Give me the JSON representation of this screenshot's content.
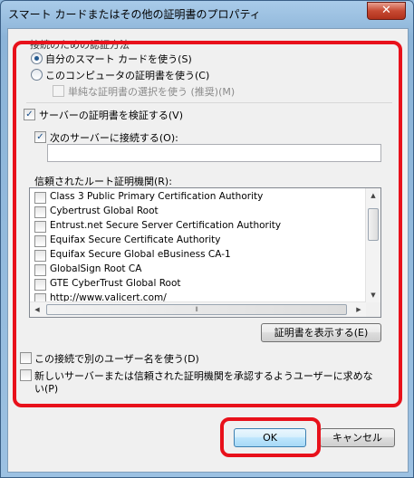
{
  "window": {
    "title": "スマート カードまたはその他の証明書のプロパティ",
    "close_symbol": "✕"
  },
  "connect_group": {
    "label": "接続のための認証方法",
    "options": [
      {
        "label": "自分のスマート カードを使う(S)",
        "selected": true
      },
      {
        "label": "このコンピュータの証明書を使う(C)",
        "selected": false
      }
    ],
    "simple_select": {
      "label": "単純な証明書の選択を使う (推奨)(M)",
      "checked": false,
      "disabled": true
    }
  },
  "verify_server": {
    "label": "サーバーの証明書を検証する(V)",
    "checked": true
  },
  "connect_server": {
    "label": "次のサーバーに接続する(O):",
    "checked": true,
    "value": ""
  },
  "trusted_roots": {
    "label": "信頼されたルート証明機関(R):",
    "items": [
      {
        "name": "Class 3 Public Primary Certification Authority",
        "checked": false
      },
      {
        "name": "Cybertrust Global Root",
        "checked": false
      },
      {
        "name": "Entrust.net Secure Server Certification Authority",
        "checked": false
      },
      {
        "name": "Equifax Secure Certificate Authority",
        "checked": false
      },
      {
        "name": "Equifax Secure Global eBusiness CA-1",
        "checked": false
      },
      {
        "name": "GlobalSign Root CA",
        "checked": false
      },
      {
        "name": "GTE CyberTrust Global Root",
        "checked": false
      },
      {
        "name": "http://www.valicert.com/",
        "checked": false
      }
    ]
  },
  "view_cert_button": "証明書を表示する(E)",
  "other_user": {
    "label": "この接続で別のユーザー名を使う(D)",
    "checked": false
  },
  "prompt_user": {
    "label_line1": "新しいサーバーまたは信頼された証明機関を承認するようユーザーに求めな",
    "label_line2": "い(P)",
    "checked": false
  },
  "buttons": {
    "ok": "OK",
    "cancel": "キャンセル"
  },
  "scroll_glyphs": {
    "up": "▲",
    "down": "▼",
    "left": "◀",
    "right": "▶",
    "grip": "⦀"
  },
  "colors": {
    "highlight": "#e8111b",
    "accent": "#24598f"
  }
}
